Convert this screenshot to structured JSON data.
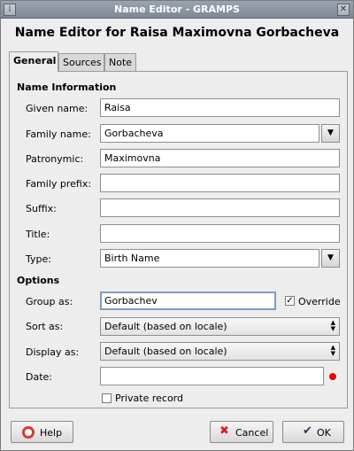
{
  "window": {
    "title": "Name Editor - GRAMPS",
    "close_glyph": "✕",
    "menu_glyph": "⁞"
  },
  "heading": "Name Editor for Raisa Maximovna Gorbacheva",
  "tabs": [
    {
      "label": "General",
      "active": true
    },
    {
      "label": "Sources",
      "active": false
    },
    {
      "label": "Note",
      "active": false
    }
  ],
  "name_information": {
    "section_title": "Name Information",
    "given_name": {
      "label": "Given name:",
      "value": "Raisa"
    },
    "family_name": {
      "label": "Family name:",
      "value": "Gorbacheva"
    },
    "patronymic": {
      "label": "Patronymic:",
      "value": "Maximovna"
    },
    "family_prefix": {
      "label": "Family prefix:",
      "value": ""
    },
    "suffix": {
      "label": "Suffix:",
      "value": ""
    },
    "title": {
      "label": "Title:",
      "value": ""
    },
    "type": {
      "label": "Type:",
      "value": "Birth Name"
    }
  },
  "options": {
    "section_title": "Options",
    "group_as": {
      "label": "Group as:",
      "value": "Gorbachev"
    },
    "override": {
      "label": "Override",
      "checked": true
    },
    "sort_as": {
      "label": "Sort as:",
      "value": "Default (based on locale)"
    },
    "display_as": {
      "label": "Display as:",
      "value": "Default (based on locale)"
    },
    "date": {
      "label": "Date:",
      "value": ""
    },
    "private_record": {
      "label": "Private record",
      "checked": false
    }
  },
  "buttons": {
    "help": "Help",
    "cancel": "Cancel",
    "ok": "OK"
  },
  "icons": {
    "dropdown": "▼",
    "spin_up": "▲",
    "spin_down": "▼",
    "check": "✓",
    "cancel": "✖",
    "ok": "✔"
  },
  "colors": {
    "date_status": "#e60000",
    "titlebar": "#8a95a1"
  }
}
